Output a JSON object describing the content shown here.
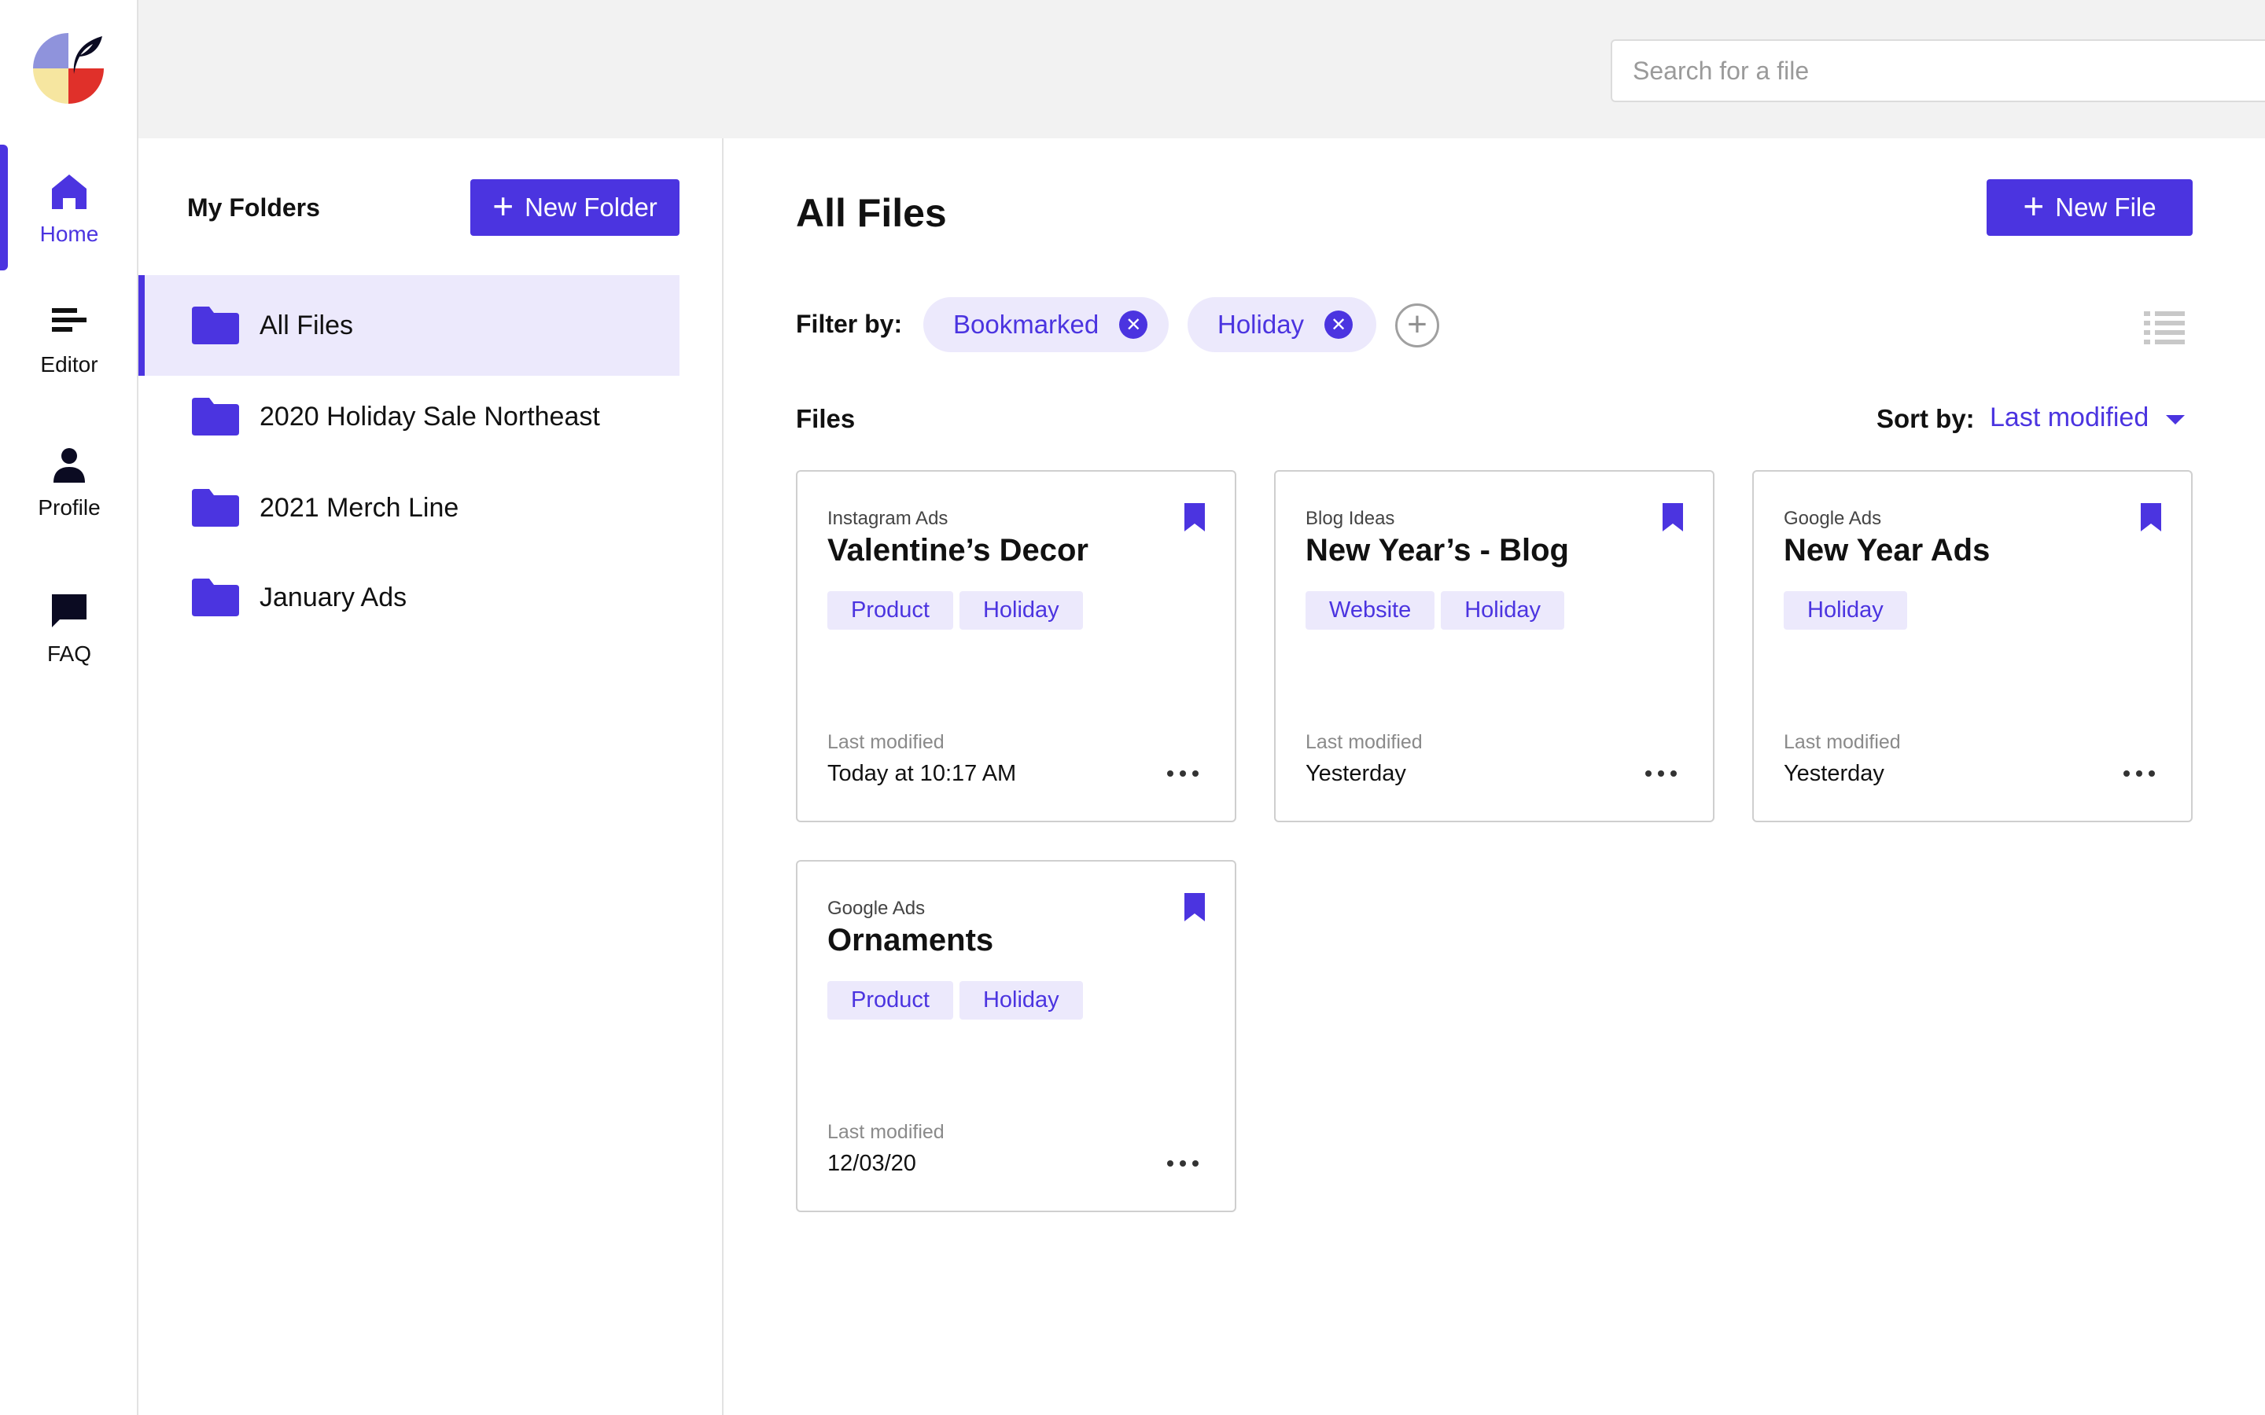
{
  "colors": {
    "accent": "#4b34e0",
    "accent_light": "#ece9fc"
  },
  "nav": {
    "items": [
      {
        "label": "Home",
        "icon": "home-icon",
        "active": true
      },
      {
        "label": "Editor",
        "icon": "editor-icon"
      },
      {
        "label": "Profile",
        "icon": "profile-icon"
      },
      {
        "label": "FAQ",
        "icon": "chat-bubble-icon"
      }
    ]
  },
  "search": {
    "placeholder": "Search for a file",
    "value": ""
  },
  "folders": {
    "title": "My Folders",
    "new_button": "New Folder",
    "items": [
      {
        "name": "All Files",
        "active": true
      },
      {
        "name": "2020 Holiday Sale Northeast"
      },
      {
        "name": "2021 Merch Line"
      },
      {
        "name": "January Ads"
      }
    ]
  },
  "main": {
    "title": "All Files",
    "new_button": "New File",
    "filter_label": "Filter by:",
    "filters": [
      "Bookmarked",
      "Holiday"
    ],
    "files_label": "Files",
    "sort_label": "Sort by:",
    "sort_value": "Last modified",
    "last_modified_label": "Last modified"
  },
  "files": [
    {
      "category": "Instagram Ads",
      "title": "Valentine’s Decor",
      "tags": [
        "Product",
        "Holiday"
      ],
      "modified": "Today at 10:17 AM",
      "bookmarked": true
    },
    {
      "category": "Blog Ideas",
      "title": "New Year’s - Blog",
      "tags": [
        "Website",
        "Holiday"
      ],
      "modified": "Yesterday",
      "bookmarked": true
    },
    {
      "category": "Google Ads",
      "title": "New Year Ads",
      "tags": [
        "Holiday"
      ],
      "modified": "Yesterday",
      "bookmarked": true
    },
    {
      "category": "Google Ads",
      "title": "Ornaments",
      "tags": [
        "Product",
        "Holiday"
      ],
      "modified": "12/03/20",
      "bookmarked": true
    }
  ]
}
